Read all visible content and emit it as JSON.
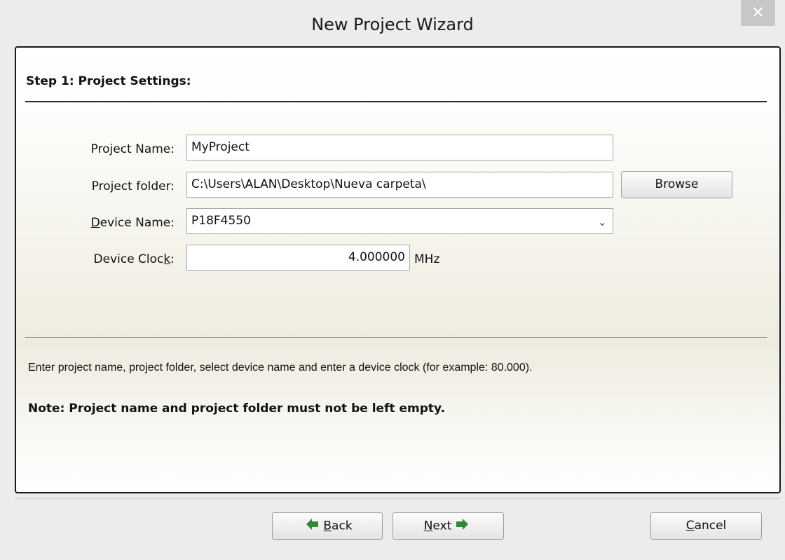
{
  "window": {
    "title": "New Project Wizard",
    "close_glyph": "✕"
  },
  "step": {
    "heading": "Step 1: Project Settings:"
  },
  "form": {
    "project_name": {
      "label": "Project Name:",
      "value": "MyProject"
    },
    "project_folder": {
      "label": "Project folder:",
      "value": "C:\\Users\\ALAN\\Desktop\\Nueva carpeta\\",
      "browse_label": "Browse"
    },
    "device_name": {
      "label_prefix": "D",
      "label_rest": "evice Name:",
      "value": "P18F4550"
    },
    "device_clock": {
      "label_prefix": "Device Cloc",
      "label_underlined": "k",
      "label_suffix": ":",
      "value": "4.000000",
      "unit": "MHz"
    }
  },
  "help": {
    "text": "Enter project name, project folder, select device name and enter a device clock (for example: 80.000).",
    "note": "Note: Project name and project folder must not be left empty."
  },
  "footer": {
    "back_underlined": "B",
    "back_rest": "ack",
    "next_underlined": "N",
    "next_rest": "ext",
    "cancel_underlined": "C",
    "cancel_rest": "ancel"
  },
  "colors": {
    "arrow_green": "#2e8b2e",
    "panel_border": "#1a1a1a"
  },
  "icons": {
    "back": "arrow-left-icon",
    "next": "arrow-right-icon",
    "select": "chevron-down-icon",
    "close": "close-icon"
  }
}
